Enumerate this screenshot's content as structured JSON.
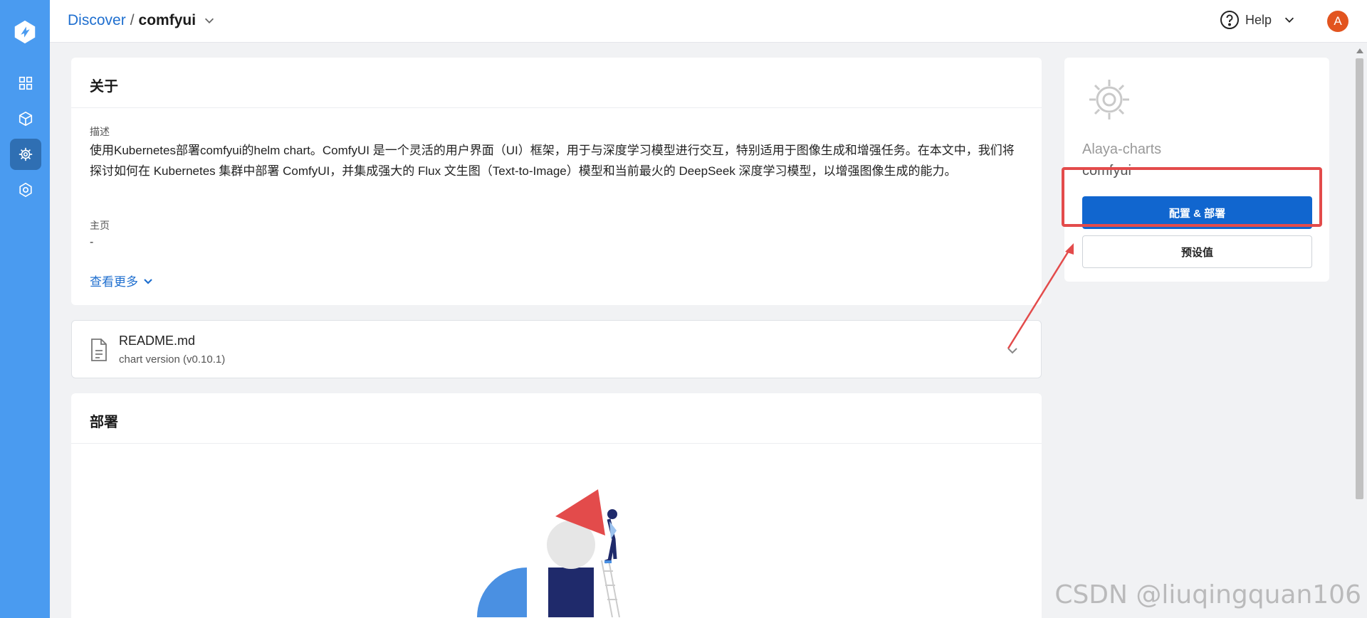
{
  "breadcrumb": {
    "parent": "Discover",
    "separator": "/",
    "current": "comfyui"
  },
  "header": {
    "help_label": "Help",
    "avatar_initial": "A"
  },
  "sidebar": {
    "items": [
      {
        "name": "dashboard-icon"
      },
      {
        "name": "package-icon"
      },
      {
        "name": "helm-icon"
      },
      {
        "name": "settings-icon"
      }
    ]
  },
  "about": {
    "title": "关于",
    "desc_label": "描述",
    "desc_text": "使用Kubernetes部署comfyui的helm chart。ComfyUI 是一个灵活的用户界面（UI）框架，用于与深度学习模型进行交互，特别适用于图像生成和增强任务。在本文中，我们将探讨如何在 Kubernetes 集群中部署 ComfyUI，并集成强大的 Flux 文生图（Text-to-Image）模型和当前最火的 DeepSeek 深度学习模型，以增强图像生成的能力。",
    "home_label": "主页",
    "home_value": "-",
    "more_label": "查看更多"
  },
  "readme": {
    "name": "README.md",
    "version": "chart version (v0.10.1)"
  },
  "deploy": {
    "title": "部署"
  },
  "side": {
    "repo": "Alaya-charts",
    "chart": "comfyui",
    "primary_button": "配置 & 部署",
    "secondary_button": "预设值"
  },
  "watermark": "CSDN @liuqingquan106",
  "colors": {
    "accent": "#1166cf",
    "sidebar": "#4a9bf0",
    "highlight": "#e34b4b",
    "avatar": "#e2541f"
  }
}
